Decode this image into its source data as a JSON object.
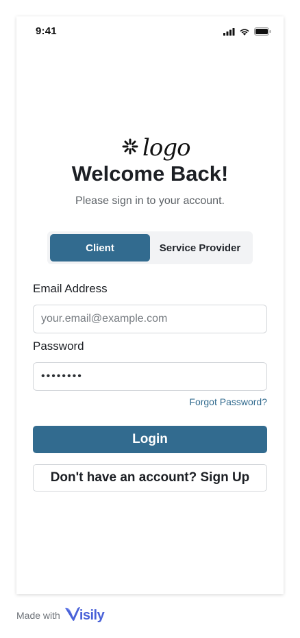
{
  "status_bar": {
    "time": "9:41",
    "icons": [
      "cellular-signal-icon",
      "wifi-icon",
      "battery-icon"
    ]
  },
  "logo": {
    "text": "logo",
    "icon": "asterisk-spark-icon"
  },
  "header": {
    "title": "Welcome Back!",
    "subtitle": "Please sign in to your account."
  },
  "role_toggle": {
    "options": [
      "Client",
      "Service Provider"
    ],
    "selected": "Client"
  },
  "form": {
    "email_label": "Email Address",
    "email_placeholder": "your.email@example.com",
    "email_value": "",
    "password_label": "Password",
    "password_value": "12345678",
    "forgot_link": "Forgot Password?",
    "login_label": "Login",
    "signup_label": "Don't have an account? Sign Up"
  },
  "footer": {
    "made_with": "Made with",
    "brand": "isily",
    "brand_icon": "visily-v-icon"
  },
  "colors": {
    "primary": "#326b8f",
    "brand": "#4a62d8",
    "text": "#1c1f24",
    "muted": "#5c6166",
    "border": "#d3d6da",
    "segment_bg": "#f2f3f5"
  }
}
